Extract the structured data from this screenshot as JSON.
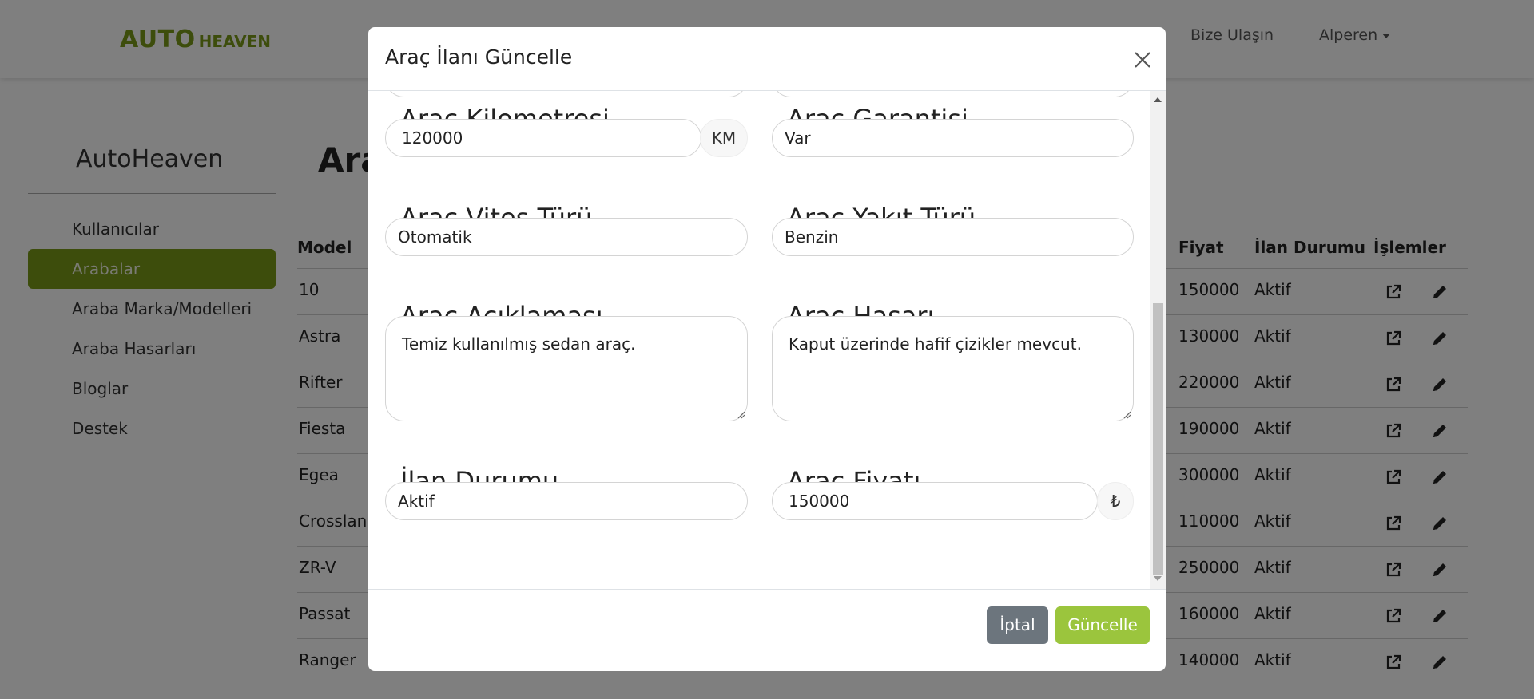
{
  "navbar": {
    "brand_main": "AUTO",
    "brand_sub": "HEAVEN",
    "contact_label": "Bize Ulaşın",
    "user_label": "Alperen"
  },
  "sidebar": {
    "title": "AutoHeaven",
    "items": [
      {
        "label": "Kullanıcılar"
      },
      {
        "label": "Arabalar"
      },
      {
        "label": "Araba Marka/Modelleri"
      },
      {
        "label": "Araba Hasarları"
      },
      {
        "label": "Bloglar"
      },
      {
        "label": "Destek"
      }
    ],
    "active_index": 1
  },
  "page": {
    "title_partial": "Ara"
  },
  "table": {
    "headers": {
      "model": "Model",
      "price": "Fiyat",
      "status": "İlan Durumu",
      "actions": "İşlemler"
    },
    "rows": [
      {
        "model": "10",
        "price": "150000",
        "status": "Aktif"
      },
      {
        "model": "Astra",
        "price": "130000",
        "status": "Aktif"
      },
      {
        "model": "Rifter",
        "price": "220000",
        "status": "Aktif"
      },
      {
        "model": "Fiesta",
        "price": "190000",
        "status": "Aktif"
      },
      {
        "model": "Egea",
        "price": "300000",
        "status": "Aktif"
      },
      {
        "model": "Crossland",
        "price": "110000",
        "status": "Aktif"
      },
      {
        "model": "ZR-V",
        "price": "250000",
        "status": "Aktif"
      },
      {
        "model": "Passat",
        "price": "160000",
        "status": "Aktif"
      },
      {
        "model": "Ranger",
        "price": "140000",
        "status": "Aktif"
      }
    ]
  },
  "modal": {
    "title": "Araç İlanı Güncelle",
    "fields": {
      "km_label": "Araç Kilometresi",
      "km_value": "120000",
      "km_unit": "KM",
      "warranty_label": "Araç Garantisi",
      "warranty_value": "Var",
      "gear_label": "Araç Vites Türü",
      "gear_value": "Otomatik",
      "fuel_label": "Araç Yakıt Türü",
      "fuel_value": "Benzin",
      "desc_label": "Araç Açıklaması",
      "desc_value": "Temiz kullanılmış sedan araç.",
      "damage_label": "Araç Hasarı",
      "damage_value": "Kaput üzerinde hafif çizikler mevcut.",
      "status_label": "İlan Durumu",
      "status_value": "Aktif",
      "price_label": "Araç Fiyatı",
      "price_value": "150000",
      "currency": "₺"
    },
    "buttons": {
      "cancel": "İptal",
      "update": "Güncelle"
    }
  },
  "colors": {
    "brand_green": "#7a9a18",
    "update_green": "#9bc53d",
    "cancel_gray": "#6c757d"
  }
}
